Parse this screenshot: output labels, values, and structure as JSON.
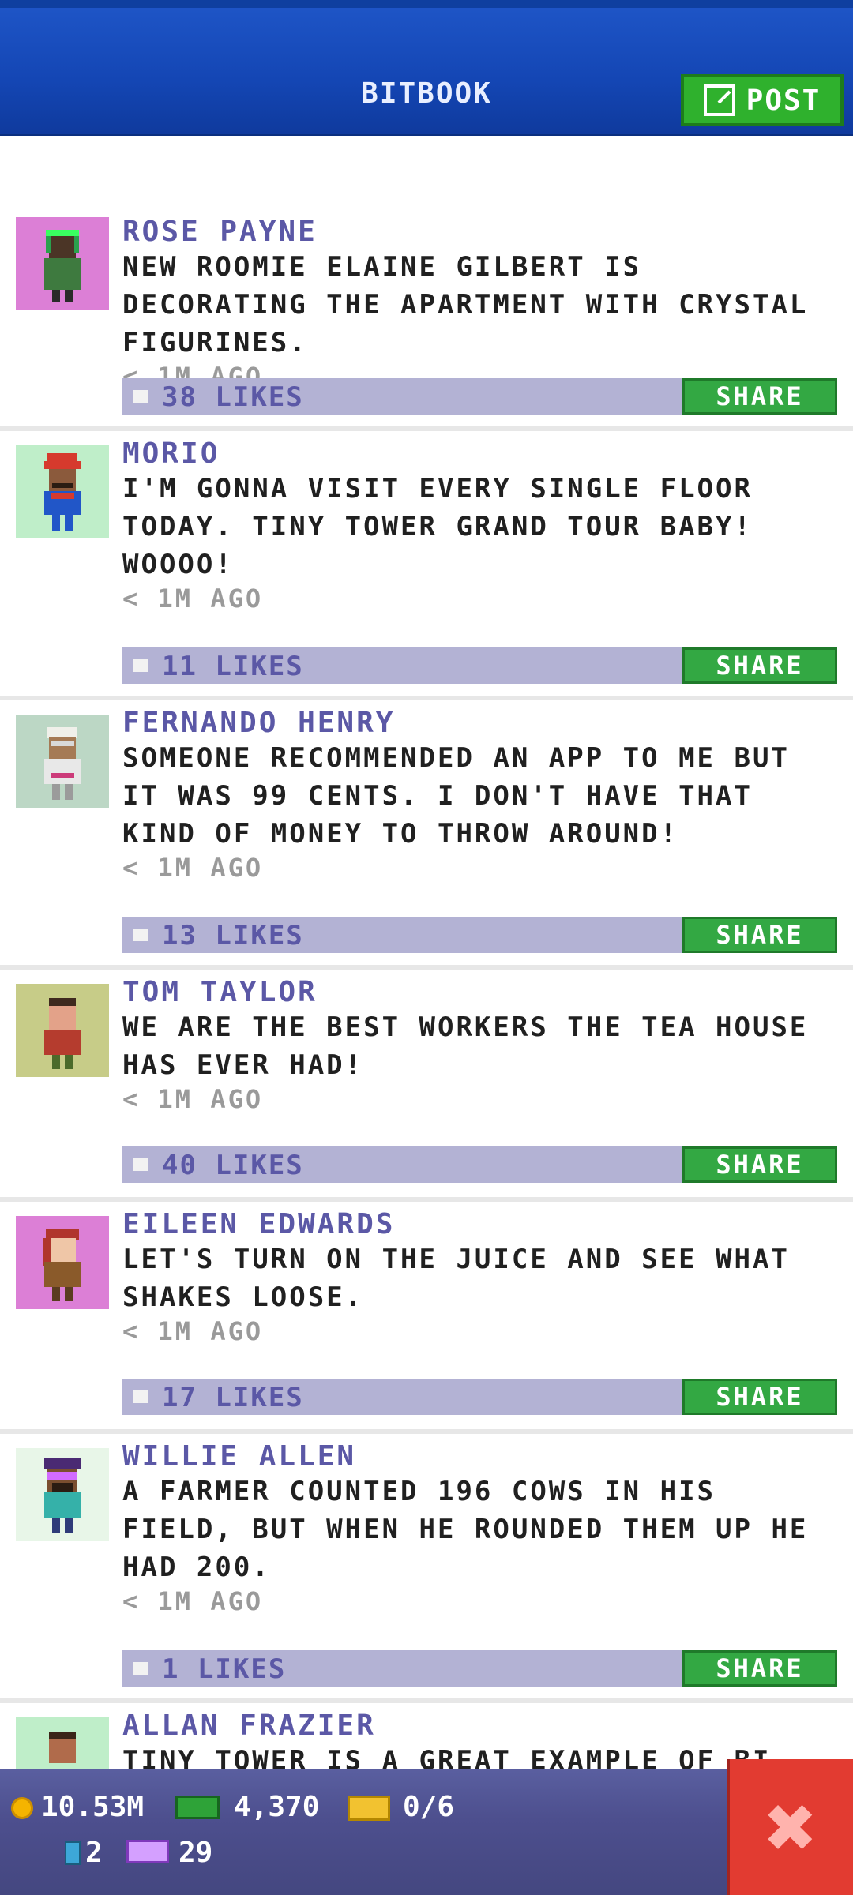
{
  "header": {
    "title": "BITBOOK",
    "post_label": "POST"
  },
  "feed": [
    {
      "name": "ROSE PAYNE",
      "text": "NEW ROOMIE ELAINE GILBERT IS DECORATING THE APARTMENT WITH CRYSTAL FIGURINES.",
      "time": "< 1M AGO",
      "likes": "38 LIKES",
      "share": "SHARE"
    },
    {
      "name": "MORIO",
      "text": "I'M GONNA VISIT EVERY SINGLE FLOOR TODAY. TINY TOWER GRAND TOUR BABY! WOOOO!",
      "time": "< 1M AGO",
      "likes": "11 LIKES",
      "share": "SHARE"
    },
    {
      "name": "FERNANDO HENRY",
      "text": "SOMEONE RECOMMENDED AN APP TO ME BUT IT WAS 99 CENTS. I DON'T HAVE THAT KIND OF MONEY TO THROW AROUND!",
      "time": "< 1M AGO",
      "likes": "13 LIKES",
      "share": "SHARE"
    },
    {
      "name": "TOM TAYLOR",
      "text": "WE ARE THE BEST WORKERS THE TEA HOUSE HAS EVER HAD!",
      "time": "< 1M AGO",
      "likes": "40 LIKES",
      "share": "SHARE"
    },
    {
      "name": "EILEEN EDWARDS",
      "text": "LET'S TURN ON THE JUICE AND SEE WHAT SHAKES LOOSE.",
      "time": "< 1M AGO",
      "likes": "17 LIKES",
      "share": "SHARE"
    },
    {
      "name": "WILLIE ALLEN",
      "text": "A FARMER COUNTED 196 COWS IN HIS FIELD, BUT WHEN HE ROUNDED THEM UP HE HAD 200.",
      "time": "< 1M AGO",
      "likes": "1 LIKES",
      "share": "SHARE"
    },
    {
      "name": "ALLAN FRAZIER",
      "text": "TINY TOWER IS A GREAT EXAMPLE OF BI...",
      "time": "",
      "likes": "",
      "share": ""
    }
  ],
  "status": {
    "coins": "10.53M",
    "bux": "4,370",
    "tickets": "0/6",
    "elevator": "2",
    "vip": "29"
  },
  "colors": {
    "header_blue": "#1446b4",
    "post_green": "#2fb12d",
    "share_green": "#33a843",
    "likes_bg": "#b3b2d4",
    "name_purple": "#5b58a6",
    "close_red": "#e23b31"
  },
  "icons": {
    "post": "edit-icon",
    "like": "thumbs-up-icon",
    "close": "close-icon",
    "coin": "coin-icon",
    "bux": "bux-icon",
    "ticket": "ticket-icon",
    "elevator": "elevator-icon",
    "vip": "vip-icon"
  }
}
